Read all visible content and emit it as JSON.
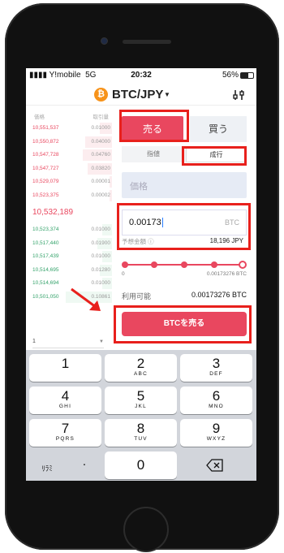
{
  "status": {
    "carrier": "Y!mobile",
    "network": "5G",
    "time": "20:32",
    "battery": "56%"
  },
  "header": {
    "pair": "BTC/JPY",
    "coin_symbol": "₿"
  },
  "book": {
    "price_header": "価格",
    "amount_header": "取引量",
    "asks": [
      {
        "price": "10,551,537",
        "amount": "0.01000",
        "fill": 0.25
      },
      {
        "price": "10,550,872",
        "amount": "0.04000",
        "fill": 0.55
      },
      {
        "price": "10,547,728",
        "amount": "0.04760",
        "fill": 0.6
      },
      {
        "price": "10,547,727",
        "amount": "0.03820",
        "fill": 0.5
      },
      {
        "price": "10,529,079",
        "amount": "0.00001",
        "fill": 0.05
      },
      {
        "price": "10,523,375",
        "amount": "0.00002",
        "fill": 0.05
      }
    ],
    "last_price": "10,532,189",
    "bids": [
      {
        "price": "10,523,374",
        "amount": "0.01000",
        "fill": 0.2
      },
      {
        "price": "10,517,440",
        "amount": "0.01900",
        "fill": 0.3
      },
      {
        "price": "10,517,439",
        "amount": "0.01000",
        "fill": 0.2
      },
      {
        "price": "10,514,695",
        "amount": "0.01280",
        "fill": 0.25
      },
      {
        "price": "10,514,694",
        "amount": "0.01000",
        "fill": 0.2
      },
      {
        "price": "10,501,050",
        "amount": "0.10861",
        "fill": 0.95
      }
    ],
    "group_value": "1"
  },
  "order": {
    "sell_tab": "売る",
    "buy_tab": "買う",
    "limit_label": "指値",
    "market_label": "成行",
    "price_placeholder": "価格",
    "quantity": "0.00173",
    "quantity_unit": "BTC",
    "estimate_label": "予想金額",
    "estimate_value": "18,196 JPY",
    "slider_min": "0",
    "slider_max": "0.00173276 BTC",
    "slider_level": 1.0,
    "available_label": "利用可能",
    "available_value": "0.00173276 BTC",
    "submit_label": "BTCを売る"
  },
  "keyboard": {
    "keys": [
      {
        "n": "1",
        "l": ""
      },
      {
        "n": "2",
        "l": "ABC"
      },
      {
        "n": "3",
        "l": "DEF"
      },
      {
        "n": "4",
        "l": "GHI"
      },
      {
        "n": "5",
        "l": "JKL"
      },
      {
        "n": "6",
        "l": "MNO"
      },
      {
        "n": "7",
        "l": "PQRS"
      },
      {
        "n": "8",
        "l": "TUV"
      },
      {
        "n": "9",
        "l": "WXYZ"
      }
    ],
    "special_left": "ﾘﾗﾐ",
    "dot": ".",
    "zero": "0"
  },
  "colors": {
    "accent": "#e9475f",
    "bid": "#35a36b",
    "highlight": "#e8201c"
  }
}
